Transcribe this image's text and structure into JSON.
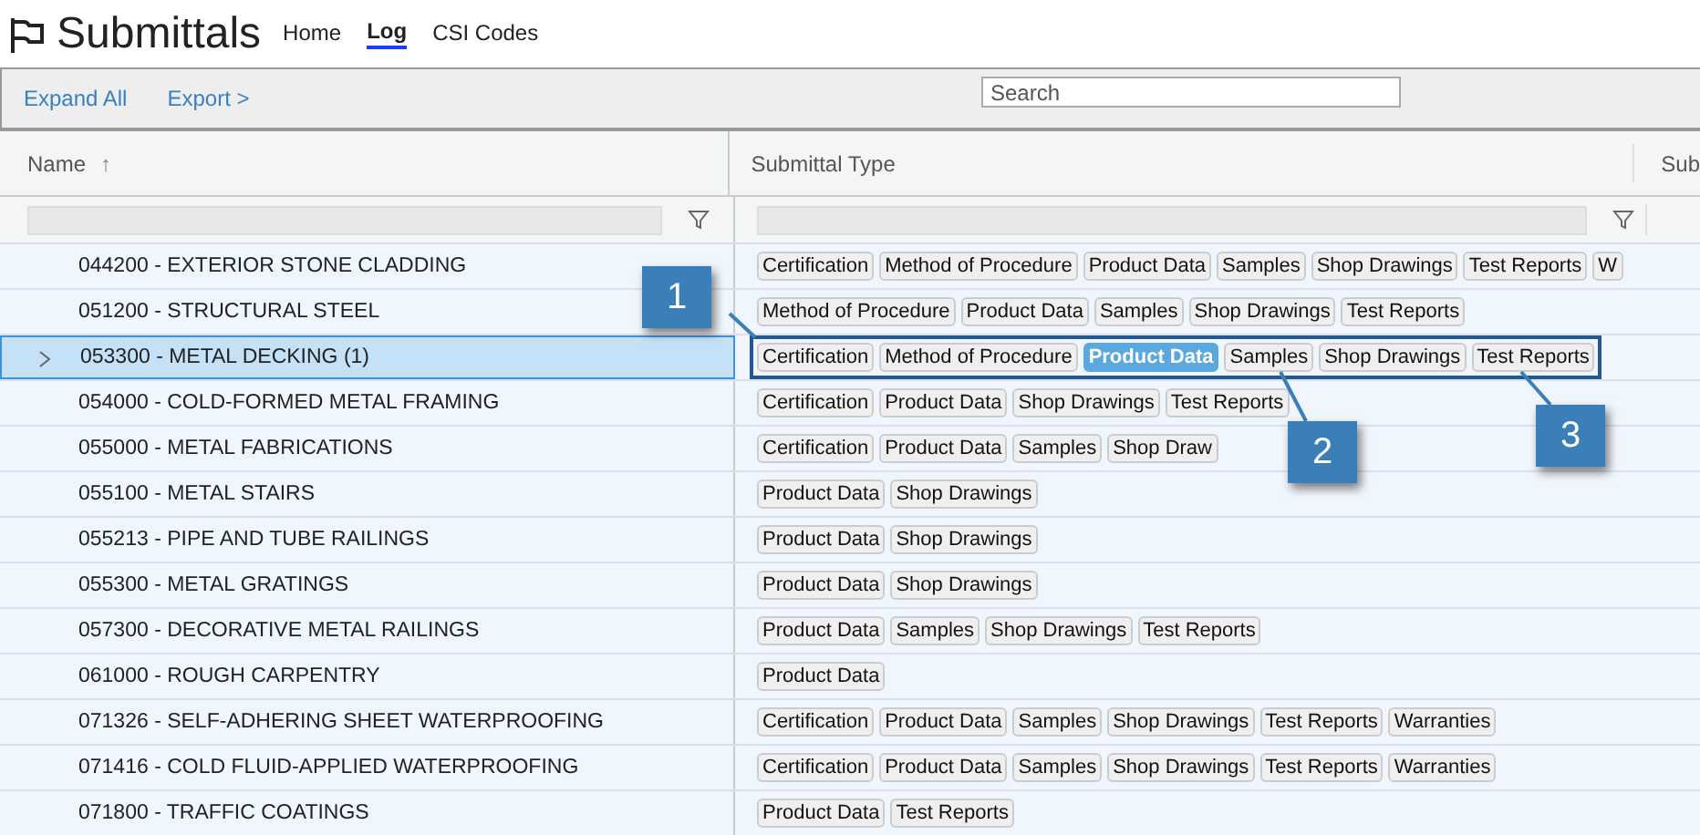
{
  "header": {
    "title": "Submittals",
    "nav": [
      {
        "label": "Home",
        "selected": false
      },
      {
        "label": "Log",
        "selected": true
      },
      {
        "label": "CSI Codes",
        "selected": false
      }
    ]
  },
  "toolbar": {
    "actions": [
      "Expand All",
      "Export >"
    ],
    "search": {
      "placeholder": "Search"
    }
  },
  "table": {
    "columns": [
      {
        "label": "Name",
        "sort": "↑",
        "filter": true
      },
      {
        "label": "Submittal Type",
        "filter": true
      },
      {
        "label": "Sub",
        "filter": false
      }
    ],
    "rows": [
      {
        "name": "044200 - EXTERIOR STONE CLADDING",
        "selected": false,
        "expandable": false,
        "highlighted": false,
        "tags": [
          {
            "label": "Certification",
            "selected": false
          },
          {
            "label": "Method of Procedure",
            "selected": false
          },
          {
            "label": "Product Data",
            "selected": false
          },
          {
            "label": "Samples",
            "selected": false
          },
          {
            "label": "Shop Drawings",
            "selected": false
          },
          {
            "label": "Test Reports",
            "selected": false
          },
          {
            "label": "W",
            "selected": false
          }
        ]
      },
      {
        "name": "051200 - STRUCTURAL STEEL",
        "selected": false,
        "expandable": false,
        "highlighted": false,
        "tags": [
          {
            "label": "Method of Procedure",
            "selected": false
          },
          {
            "label": "Product Data",
            "selected": false
          },
          {
            "label": "Samples",
            "selected": false
          },
          {
            "label": "Shop Drawings",
            "selected": false
          },
          {
            "label": "Test Reports",
            "selected": false
          }
        ]
      },
      {
        "name": "053300 - METAL DECKING (1)",
        "selected": true,
        "expandable": true,
        "highlighted": true,
        "tags": [
          {
            "label": "Certification",
            "selected": false
          },
          {
            "label": "Method of Procedure",
            "selected": false
          },
          {
            "label": "Product Data",
            "selected": true
          },
          {
            "label": "Samples",
            "selected": false
          },
          {
            "label": "Shop Drawings",
            "selected": false
          },
          {
            "label": "Test Reports",
            "selected": false
          }
        ]
      },
      {
        "name": "054000 - COLD-FORMED METAL FRAMING",
        "selected": false,
        "expandable": false,
        "highlighted": false,
        "tags": [
          {
            "label": "Certification",
            "selected": false
          },
          {
            "label": "Product Data",
            "selected": false
          },
          {
            "label": "Shop Drawings",
            "selected": false
          },
          {
            "label": "Test Reports",
            "selected": false
          }
        ]
      },
      {
        "name": "055000 - METAL FABRICATIONS",
        "selected": false,
        "expandable": false,
        "highlighted": false,
        "tags": [
          {
            "label": "Certification",
            "selected": false
          },
          {
            "label": "Product Data",
            "selected": false
          },
          {
            "label": "Samples",
            "selected": false
          },
          {
            "label": "Shop Draw",
            "selected": false
          }
        ]
      },
      {
        "name": "055100 - METAL STAIRS",
        "selected": false,
        "expandable": false,
        "highlighted": false,
        "tags": [
          {
            "label": "Product Data",
            "selected": false
          },
          {
            "label": "Shop Drawings",
            "selected": false
          }
        ]
      },
      {
        "name": "055213 - PIPE AND TUBE RAILINGS",
        "selected": false,
        "expandable": false,
        "highlighted": false,
        "tags": [
          {
            "label": "Product Data",
            "selected": false
          },
          {
            "label": "Shop Drawings",
            "selected": false
          }
        ]
      },
      {
        "name": "055300 - METAL GRATINGS",
        "selected": false,
        "expandable": false,
        "highlighted": false,
        "tags": [
          {
            "label": "Product Data",
            "selected": false
          },
          {
            "label": "Shop Drawings",
            "selected": false
          }
        ]
      },
      {
        "name": "057300 - DECORATIVE METAL RAILINGS",
        "selected": false,
        "expandable": false,
        "highlighted": false,
        "tags": [
          {
            "label": "Product Data",
            "selected": false
          },
          {
            "label": "Samples",
            "selected": false
          },
          {
            "label": "Shop Drawings",
            "selected": false
          },
          {
            "label": "Test Reports",
            "selected": false
          }
        ]
      },
      {
        "name": "061000 - ROUGH CARPENTRY",
        "selected": false,
        "expandable": false,
        "highlighted": false,
        "tags": [
          {
            "label": "Product Data",
            "selected": false
          }
        ]
      },
      {
        "name": "071326 - SELF-ADHERING SHEET WATERPROOFING",
        "selected": false,
        "expandable": false,
        "highlighted": false,
        "tags": [
          {
            "label": "Certification",
            "selected": false
          },
          {
            "label": "Product Data",
            "selected": false
          },
          {
            "label": "Samples",
            "selected": false
          },
          {
            "label": "Shop Drawings",
            "selected": false
          },
          {
            "label": "Test Reports",
            "selected": false
          },
          {
            "label": "Warranties",
            "selected": false
          }
        ]
      },
      {
        "name": "071416 - COLD FLUID-APPLIED WATERPROOFING",
        "selected": false,
        "expandable": false,
        "highlighted": false,
        "tags": [
          {
            "label": "Certification",
            "selected": false
          },
          {
            "label": "Product Data",
            "selected": false
          },
          {
            "label": "Samples",
            "selected": false
          },
          {
            "label": "Shop Drawings",
            "selected": false
          },
          {
            "label": "Test Reports",
            "selected": false
          },
          {
            "label": "Warranties",
            "selected": false
          }
        ]
      },
      {
        "name": "071800 - TRAFFIC COATINGS",
        "selected": false,
        "expandable": false,
        "highlighted": false,
        "tags": [
          {
            "label": "Product Data",
            "selected": false
          },
          {
            "label": "Test Reports",
            "selected": false
          }
        ]
      }
    ]
  },
  "callouts": [
    {
      "label": "1"
    },
    {
      "label": "2"
    },
    {
      "label": "3"
    }
  ]
}
